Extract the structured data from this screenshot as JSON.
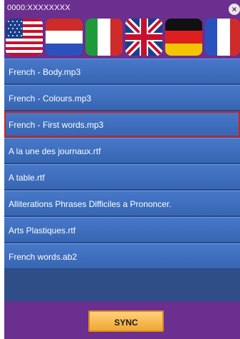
{
  "header": {
    "device_id": "0000:XXXXXXXX"
  },
  "flags": [
    {
      "name": "usa-flag-icon"
    },
    {
      "name": "netherlands-flag-icon"
    },
    {
      "name": "italy-flag-icon"
    },
    {
      "name": "uk-flag-icon"
    },
    {
      "name": "germany-flag-icon"
    },
    {
      "name": "france-flag-icon"
    }
  ],
  "files": [
    {
      "label": "French - Body.mp3"
    },
    {
      "label": "French - Colours.mp3"
    },
    {
      "label": "French - First words.mp3",
      "selected": true
    },
    {
      "label": "A la une des journaux.rtf"
    },
    {
      "label": "A table.rtf"
    },
    {
      "label": "Alliterations Phrases Difficiles a Prononcer."
    },
    {
      "label": "Arts Plastiques.rtf"
    },
    {
      "label": "French words.ab2"
    }
  ],
  "footer": {
    "sync_label": "SYNC"
  },
  "colors": {
    "frame": "#6a2f8f",
    "list_item": "#3f6fc0",
    "selection": "#d22020",
    "sync": "#f5b54a"
  }
}
